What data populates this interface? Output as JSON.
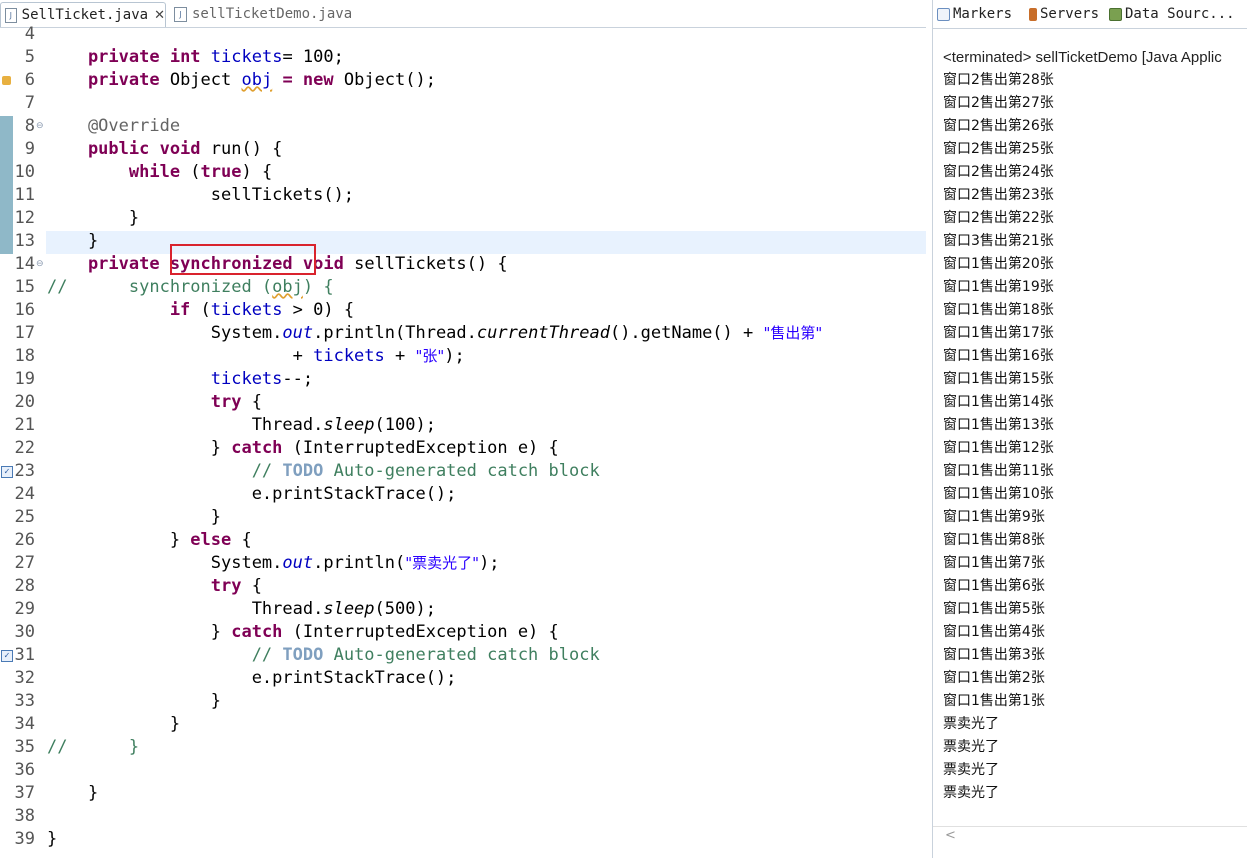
{
  "editor": {
    "tabs": [
      {
        "label": "SellTicket.java",
        "active": true
      },
      {
        "label": "sellTicketDemo.java",
        "active": false
      }
    ],
    "lines": [
      {
        "n": "4",
        "seg": []
      },
      {
        "n": "5",
        "seg": [
          [
            "kw",
            "    private "
          ],
          [
            "kw",
            "int "
          ],
          [
            "fld",
            "tickets"
          ],
          [
            "",
            "= 100;"
          ]
        ]
      },
      {
        "n": "6",
        "seg": [
          [
            "kw",
            "    private "
          ],
          [
            "",
            "Object "
          ],
          [
            "fldsq",
            "obj"
          ],
          [
            "",
            ""
          ],
          [
            "kw",
            " = new "
          ],
          [
            "",
            "Object();"
          ]
        ]
      },
      {
        "n": "7",
        "seg": []
      },
      {
        "n": "8",
        "seg": [
          [
            "ann",
            "    @Override"
          ]
        ]
      },
      {
        "n": "9",
        "seg": [
          [
            "kw",
            "    public void "
          ],
          [
            "",
            "run() {"
          ]
        ]
      },
      {
        "n": "10",
        "seg": [
          [
            "kw",
            "        while "
          ],
          [
            "",
            "("
          ],
          [
            "kw",
            "true"
          ],
          [
            "",
            ") {"
          ]
        ]
      },
      {
        "n": "11",
        "seg": [
          [
            "",
            "                sellTickets();"
          ]
        ]
      },
      {
        "n": "12",
        "seg": [
          [
            "",
            "        }"
          ]
        ]
      },
      {
        "n": "13",
        "seg": [
          [
            "",
            "    }"
          ]
        ]
      },
      {
        "n": "14",
        "seg": [
          [
            "kw",
            "    private "
          ],
          [
            "kw",
            "synchronized "
          ],
          [
            "kw",
            "void "
          ],
          [
            "",
            "sellTickets() {"
          ]
        ]
      },
      {
        "n": "15",
        "seg": [
          [
            "com",
            "//      synchronized ("
          ],
          [
            "comsq",
            "obj"
          ],
          [
            "com",
            ") {"
          ]
        ]
      },
      {
        "n": "16",
        "seg": [
          [
            "kw",
            "            if "
          ],
          [
            "",
            "("
          ],
          [
            "fld",
            "tickets"
          ],
          [
            "",
            " > 0) {"
          ]
        ]
      },
      {
        "n": "17",
        "seg": [
          [
            "",
            "                System."
          ],
          [
            "sitalic",
            "out"
          ],
          [
            "",
            ".println(Thread."
          ],
          [
            "it",
            "currentThread"
          ],
          [
            "",
            "().getName() + "
          ],
          [
            "str",
            "\"售出第\""
          ]
        ]
      },
      {
        "n": "18",
        "seg": [
          [
            "",
            "                        + "
          ],
          [
            "fld",
            "tickets"
          ],
          [
            "",
            " + "
          ],
          [
            "str",
            "\"张\""
          ],
          [
            "",
            ");"
          ]
        ]
      },
      {
        "n": "19",
        "seg": [
          [
            "fld",
            "                tickets"
          ],
          [
            "",
            "--;"
          ]
        ]
      },
      {
        "n": "20",
        "seg": [
          [
            "kw",
            "                try "
          ],
          [
            "",
            "{"
          ]
        ]
      },
      {
        "n": "21",
        "seg": [
          [
            "",
            "                    Thread."
          ],
          [
            "it",
            "sleep"
          ],
          [
            "",
            "(100);"
          ]
        ]
      },
      {
        "n": "22",
        "seg": [
          [
            "",
            "                } "
          ],
          [
            "kw",
            "catch "
          ],
          [
            "",
            "(InterruptedException e) {"
          ]
        ]
      },
      {
        "n": "23",
        "seg": [
          [
            "com",
            "                    // "
          ],
          [
            "todo",
            "TODO"
          ],
          [
            "com",
            " Auto-generated catch block"
          ]
        ]
      },
      {
        "n": "24",
        "seg": [
          [
            "",
            "                    e.printStackTrace();"
          ]
        ]
      },
      {
        "n": "25",
        "seg": [
          [
            "",
            "                }"
          ]
        ]
      },
      {
        "n": "26",
        "seg": [
          [
            "",
            "            } "
          ],
          [
            "kw",
            "else "
          ],
          [
            "",
            "{"
          ]
        ]
      },
      {
        "n": "27",
        "seg": [
          [
            "",
            "                System."
          ],
          [
            "sitalic",
            "out"
          ],
          [
            "",
            ".println("
          ],
          [
            "str",
            "\"票卖光了\""
          ],
          [
            "",
            ");"
          ]
        ]
      },
      {
        "n": "28",
        "seg": [
          [
            "kw",
            "                try "
          ],
          [
            "",
            "{"
          ]
        ]
      },
      {
        "n": "29",
        "seg": [
          [
            "",
            "                    Thread."
          ],
          [
            "it",
            "sleep"
          ],
          [
            "",
            "(500);"
          ]
        ]
      },
      {
        "n": "30",
        "seg": [
          [
            "",
            "                } "
          ],
          [
            "kw",
            "catch "
          ],
          [
            "",
            "(InterruptedException e) {"
          ]
        ]
      },
      {
        "n": "31",
        "seg": [
          [
            "com",
            "                    // "
          ],
          [
            "todo",
            "TODO"
          ],
          [
            "com",
            " Auto-generated catch block"
          ]
        ]
      },
      {
        "n": "32",
        "seg": [
          [
            "",
            "                    e.printStackTrace();"
          ]
        ]
      },
      {
        "n": "33",
        "seg": [
          [
            "",
            "                }"
          ]
        ]
      },
      {
        "n": "34",
        "seg": [
          [
            "",
            "            }"
          ]
        ]
      },
      {
        "n": "35",
        "seg": [
          [
            "com",
            "//      }"
          ]
        ]
      },
      {
        "n": "36",
        "seg": []
      },
      {
        "n": "37",
        "seg": [
          [
            "",
            "    }"
          ]
        ]
      },
      {
        "n": "38",
        "seg": []
      },
      {
        "n": "39",
        "seg": [
          [
            "",
            "}"
          ]
        ]
      }
    ],
    "highlight_text": "synchronized",
    "colors": {
      "keyword": "#7f0055",
      "field": "#0000c0",
      "comment": "#3f7f5f",
      "string": "#2a00ff",
      "highlight_box": "#d9232d"
    }
  },
  "console": {
    "tabs": [
      {
        "label": "Markers",
        "icon": "markers-icon"
      },
      {
        "label": "Servers",
        "icon": "servers-icon"
      },
      {
        "label": "Data Sourc...",
        "icon": "data-source-icon"
      }
    ],
    "header": "<terminated> sellTicketDemo [Java Applic",
    "output": [
      "窗口2售出第28张",
      "窗口2售出第27张",
      "窗口2售出第26张",
      "窗口2售出第25张",
      "窗口2售出第24张",
      "窗口2售出第23张",
      "窗口2售出第22张",
      "窗口3售出第21张",
      "窗口1售出第20张",
      "窗口1售出第19张",
      "窗口1售出第18张",
      "窗口1售出第17张",
      "窗口1售出第16张",
      "窗口1售出第15张",
      "窗口1售出第14张",
      "窗口1售出第13张",
      "窗口1售出第12张",
      "窗口1售出第11张",
      "窗口1售出第10张",
      "窗口1售出第9张",
      "窗口1售出第8张",
      "窗口1售出第7张",
      "窗口1售出第6张",
      "窗口1售出第5张",
      "窗口1售出第4张",
      "窗口1售出第3张",
      "窗口1售出第2张",
      "窗口1售出第1张",
      "票卖光了",
      "票卖光了",
      "票卖光了",
      "票卖光了"
    ]
  }
}
